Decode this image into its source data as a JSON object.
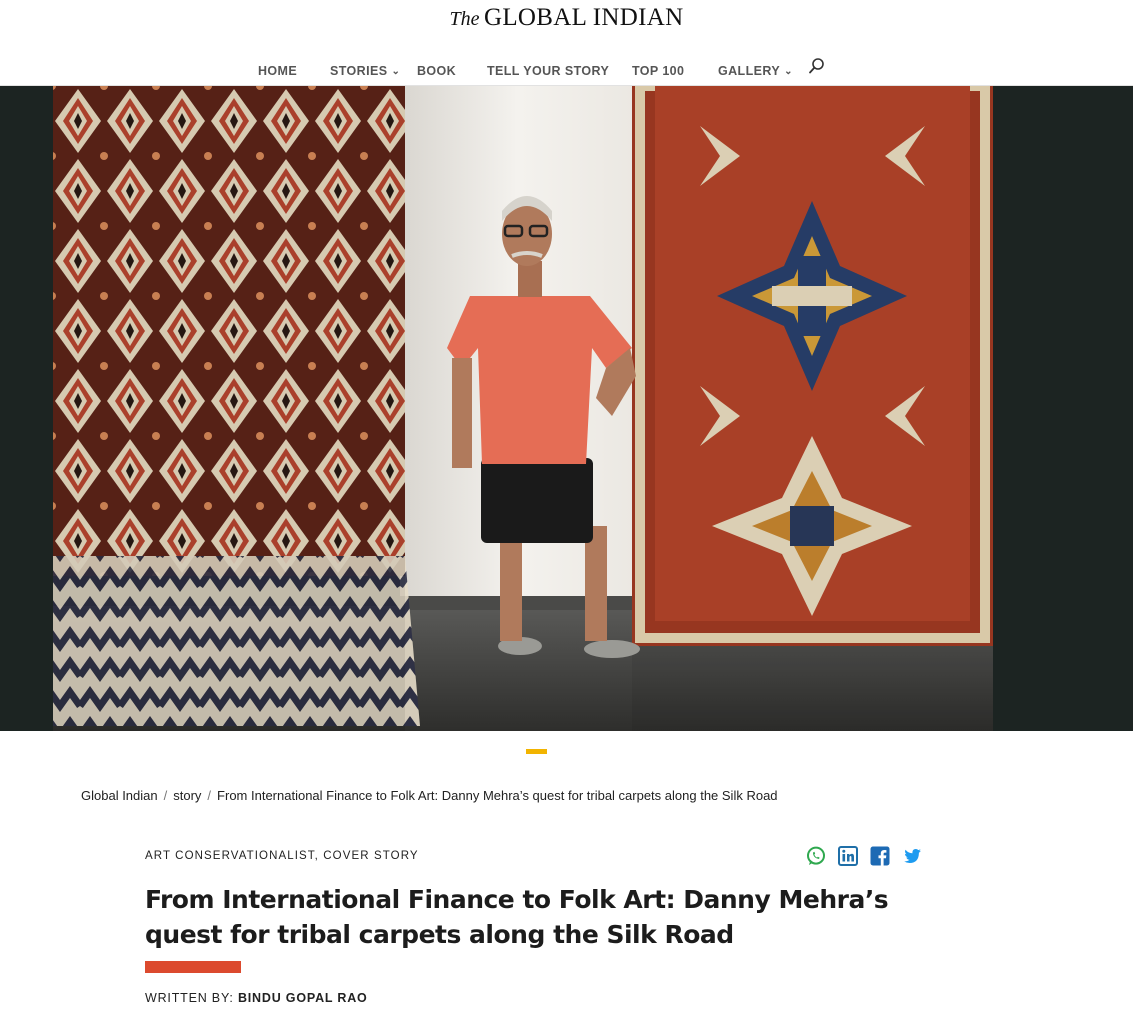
{
  "site": {
    "logo_prefix": "The",
    "logo_name": "GLOBAL INDIAN"
  },
  "nav": {
    "items": [
      {
        "label": "HOME"
      },
      {
        "label": "STORIES",
        "has_dropdown": true
      },
      {
        "label": "BOOK"
      },
      {
        "label": "TELL YOUR STORY"
      },
      {
        "label": "TOP 100"
      },
      {
        "label": "GALLERY",
        "has_dropdown": true
      }
    ],
    "search_icon": "search-icon"
  },
  "hero": {
    "description_icon": "photo"
  },
  "breadcrumb": {
    "items": [
      {
        "label": "Global Indian"
      },
      {
        "label": "story"
      },
      {
        "label": "From International Finance to Folk Art: Danny Mehra’s quest for tribal carpets along the Silk Road"
      }
    ],
    "separator": "/"
  },
  "article": {
    "categories": [
      "ART CONSERVATIONALIST",
      "COVER STORY"
    ],
    "category_separator": ", ",
    "title": "From International Finance to Folk Art: Danny Mehra’s quest for tribal carpets along the Silk Road",
    "byline_label": "WRITTEN BY:",
    "author": "BINDU GOPAL RAO"
  },
  "share": {
    "icons": [
      "whatsapp-icon",
      "linkedin-icon",
      "facebook-icon",
      "twitter-icon"
    ]
  },
  "colors": {
    "accent_yellow": "#f2b400",
    "accent_red": "#dc4a2e",
    "whatsapp": "#2fa84f",
    "linkedin": "#1f6fa8",
    "facebook": "#1d6ab4",
    "twitter": "#1d9bf0"
  }
}
